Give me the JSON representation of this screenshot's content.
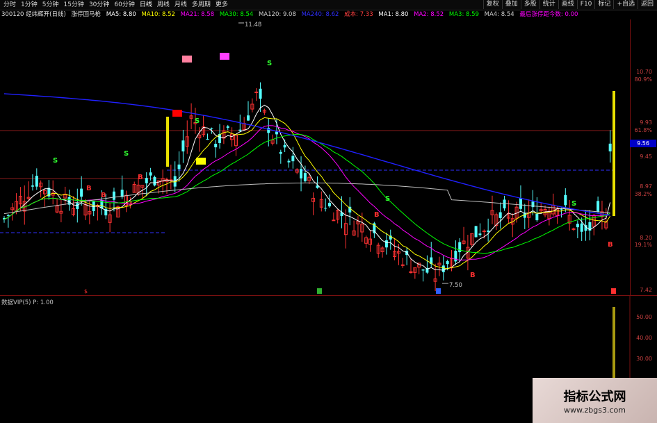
{
  "toolbar": {
    "periods": [
      "分时",
      "1分钟",
      "5分钟",
      "15分钟",
      "30分钟",
      "60分钟",
      "日线",
      "周线",
      "月线",
      "多周期",
      "更多"
    ],
    "active_period": "日线",
    "tools": [
      "复权",
      "叠加",
      "多股",
      "统计",
      "画线",
      "F10",
      "标记",
      "+自选",
      "返回"
    ]
  },
  "legend": {
    "stock": "300120 经纬辉开(日线)",
    "indicator_name": "涨停回马枪",
    "ma5": "MA5: 8.80",
    "ma10": "MA10: 8.52",
    "ma21": "MA21: 8.58",
    "ma30": "MA30: 8.54",
    "ma120": "MA120: 9.08",
    "ma240": "MA240: 8.62",
    "cost": "成本: 7.33",
    "a1": "MA1: 8.80",
    "a2": "MA2: 8.52",
    "a3": "MA3: 8.59",
    "a4": "MA4: 8.54",
    "days_since": "最后涨停距今数: 0.00"
  },
  "colors": {
    "up": "#ff3232",
    "down": "#54ffff",
    "ma5": "#ffffff",
    "ma10": "#ffff00",
    "ma21": "#ff00ff",
    "ma30": "#00ff00",
    "ma120": "#c0c0c0",
    "ma240": "#2020ff",
    "accent": "#c84040"
  },
  "y_axis": {
    "labels": [
      "10.70",
      "80.9%",
      "9.93",
      "61.8%",
      "9.45",
      "8.97",
      "38.2%",
      "8.20",
      "19.1%",
      "7.42"
    ],
    "current_price": "9.56"
  },
  "annotations": {
    "high": "11.48",
    "low": "7.50",
    "sell_markers": [
      "S",
      "S",
      "S",
      "S",
      "S",
      "S"
    ],
    "buy_markers": [
      "B",
      "B",
      "B",
      "B",
      "B",
      "B"
    ]
  },
  "subpanel": {
    "legend": "数据VIP(5)  P: 1.00",
    "y_labels": [
      "50.00",
      "40.00",
      "30.00"
    ]
  },
  "watermark": {
    "title": "指标公式网",
    "url": "www.zbgs3.com"
  }
}
